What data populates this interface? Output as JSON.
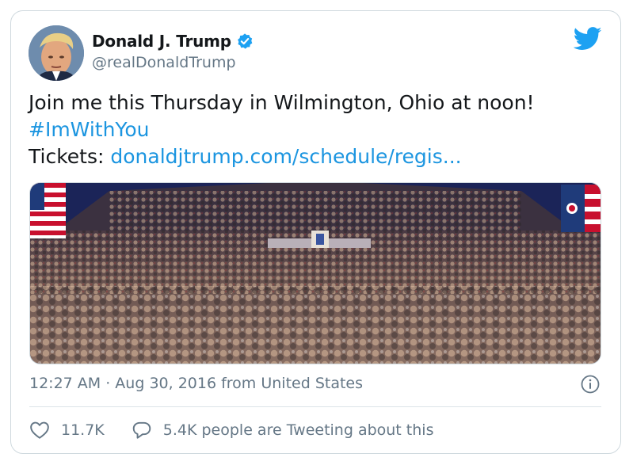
{
  "tweet": {
    "author_name": "Donald J. Trump",
    "handle": "@realDonaldTrump",
    "text_line1": "Join me this Thursday in Wilmington, Ohio at noon!",
    "hashtag": "#ImWithYou",
    "tickets_label": "Tickets: ",
    "tickets_link": "donaldjtrump.com/schedule/regis...",
    "timestamp": "12:27 AM · Aug 30, 2016 from United States",
    "likes": "11.7K",
    "retweet_text": "5.4K people are Tweeting about this"
  },
  "icons": {
    "verified": "verified-badge-icon",
    "platform": "twitter-bird-icon",
    "info": "info-icon",
    "like": "heart-icon",
    "reply": "speech-bubble-icon"
  },
  "colors": {
    "link": "#1b95e0",
    "verified": "#1da1f2",
    "secondary_text": "#657786",
    "border": "#cfd9de"
  }
}
